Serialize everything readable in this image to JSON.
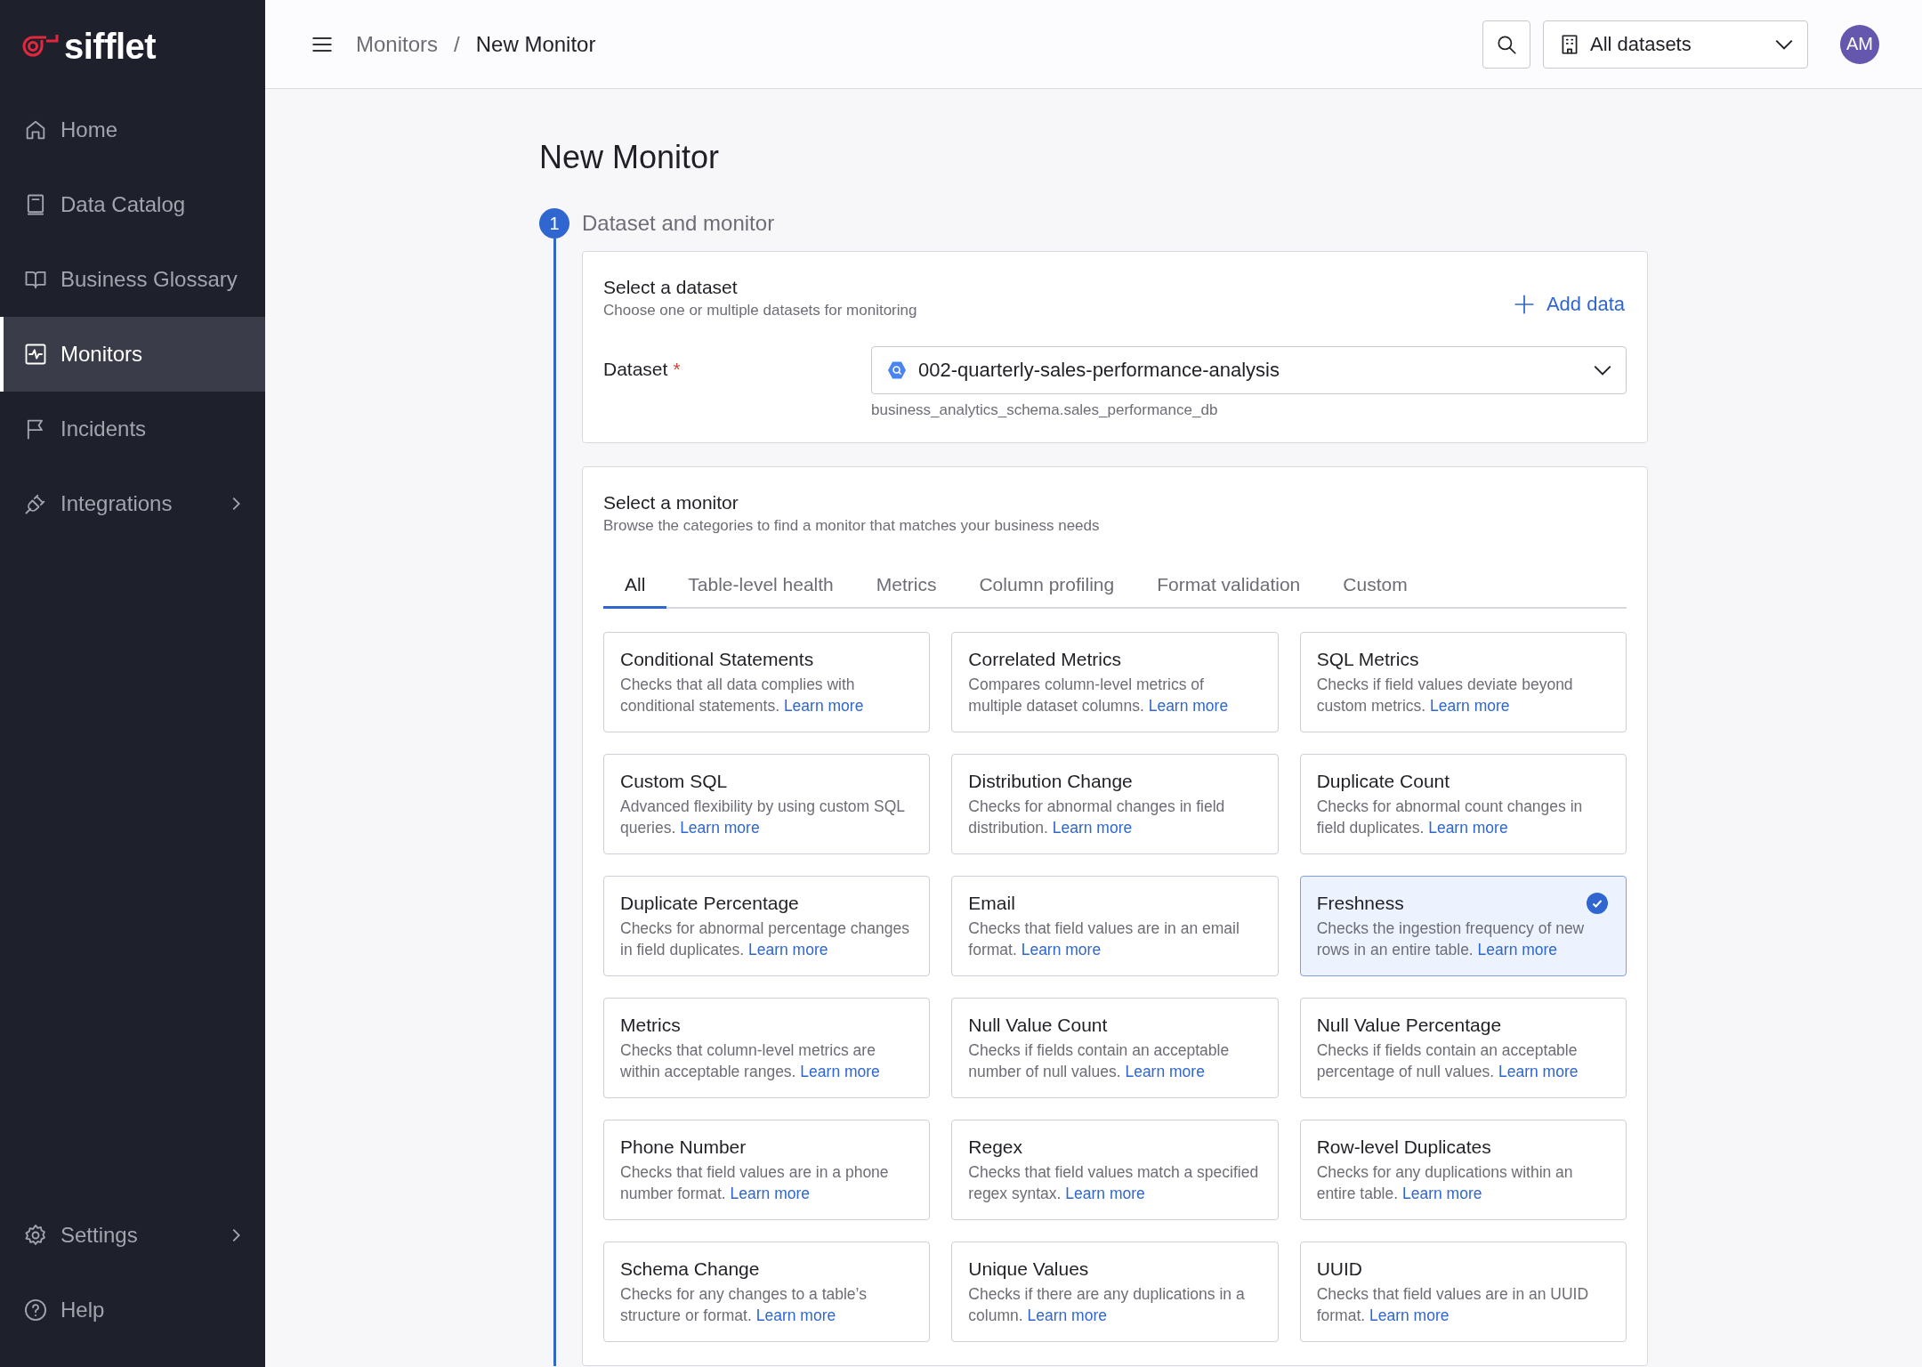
{
  "sidebar": {
    "logo": "sifflet",
    "items": [
      {
        "label": "Home",
        "selected": false,
        "expandable": false
      },
      {
        "label": "Data Catalog",
        "selected": false,
        "expandable": false
      },
      {
        "label": "Business Glossary",
        "selected": false,
        "expandable": false
      },
      {
        "label": "Monitors",
        "selected": true,
        "expandable": false
      },
      {
        "label": "Incidents",
        "selected": false,
        "expandable": false
      },
      {
        "label": "Integrations",
        "selected": false,
        "expandable": true
      }
    ],
    "bottom_items": [
      {
        "label": "Settings",
        "selected": false,
        "expandable": true
      },
      {
        "label": "Help",
        "selected": false,
        "expandable": false
      }
    ]
  },
  "header": {
    "breadcrumb": [
      "Monitors",
      "New Monitor"
    ],
    "separator": "/",
    "dataset_filter": "All datasets",
    "avatar": "AM"
  },
  "page": {
    "title": "New Monitor",
    "step": {
      "number": "1",
      "label": "Dataset and monitor"
    },
    "dataset_card": {
      "title": "Select a dataset",
      "subtitle": "Choose one or multiple datasets for monitoring",
      "add_button": "Add data",
      "field_label": "Dataset",
      "required_mark": "*",
      "value": "002-quarterly-sales-performance-analysis",
      "hint": "business_analytics_schema.sales_performance_db"
    },
    "monitor_card": {
      "title": "Select a monitor",
      "subtitle": "Browse the categories to find a monitor that matches your business needs",
      "tabs": [
        {
          "label": "All",
          "selected": true
        },
        {
          "label": "Table-level health",
          "selected": false
        },
        {
          "label": "Metrics",
          "selected": false
        },
        {
          "label": "Column profiling",
          "selected": false
        },
        {
          "label": "Format validation",
          "selected": false
        },
        {
          "label": "Custom",
          "selected": false
        }
      ],
      "monitors": [
        {
          "name": "Conditional Statements",
          "description": "Checks that all data complies with conditional statements.",
          "link": "Learn more",
          "selected": false
        },
        {
          "name": "Correlated Metrics",
          "description": "Compares column-level metrics of multiple dataset columns.",
          "link": "Learn more",
          "selected": false
        },
        {
          "name": "SQL Metrics",
          "description": "Checks if field values deviate beyond custom metrics.",
          "link": "Learn more",
          "selected": false
        },
        {
          "name": "Custom SQL",
          "description": "Advanced flexibility by using custom SQL queries.",
          "link": "Learn more",
          "selected": false
        },
        {
          "name": "Distribution Change",
          "description": "Checks for abnormal changes in field distribution.",
          "link": "Learn more",
          "selected": false
        },
        {
          "name": "Duplicate Count",
          "description": "Checks for abnormal count changes in field duplicates.",
          "link": "Learn more",
          "selected": false
        },
        {
          "name": "Duplicate Percentage",
          "description": "Checks for abnormal percentage changes in field duplicates.",
          "link": "Learn more",
          "selected": false
        },
        {
          "name": "Email",
          "description": "Checks that field values are in an email format.",
          "link": "Learn more",
          "selected": false
        },
        {
          "name": "Freshness",
          "description": "Checks the ingestion frequency of new rows in an entire table.",
          "link": "Learn more",
          "selected": true
        },
        {
          "name": "Metrics",
          "description": "Checks that column-level metrics are within acceptable ranges.",
          "link": "Learn more",
          "selected": false
        },
        {
          "name": "Null Value Count",
          "description": "Checks if fields contain an acceptable number of null values.",
          "link": "Learn more",
          "selected": false
        },
        {
          "name": "Null Value Percentage",
          "description": "Checks if fields contain an acceptable percentage of null values.",
          "link": "Learn more",
          "selected": false
        },
        {
          "name": "Phone Number",
          "description": "Checks that field values are in a phone number format.",
          "link": "Learn more",
          "selected": false
        },
        {
          "name": "Regex",
          "description": "Checks that field values match a specified regex syntax.",
          "link": "Learn more",
          "selected": false
        },
        {
          "name": "Row-level Duplicates",
          "description": "Checks for any duplications within an entire table.",
          "link": "Learn more",
          "selected": false
        },
        {
          "name": "Schema Change",
          "description": "Checks for any changes to a table’s structure or format.",
          "link": "Learn more",
          "selected": false
        },
        {
          "name": "Unique Values",
          "description": "Checks if there are any duplications in a column.",
          "link": "Learn more",
          "selected": false
        },
        {
          "name": "UUID",
          "description": "Checks that field values are in an UUID format.",
          "link": "Learn more",
          "selected": false
        }
      ]
    }
  }
}
